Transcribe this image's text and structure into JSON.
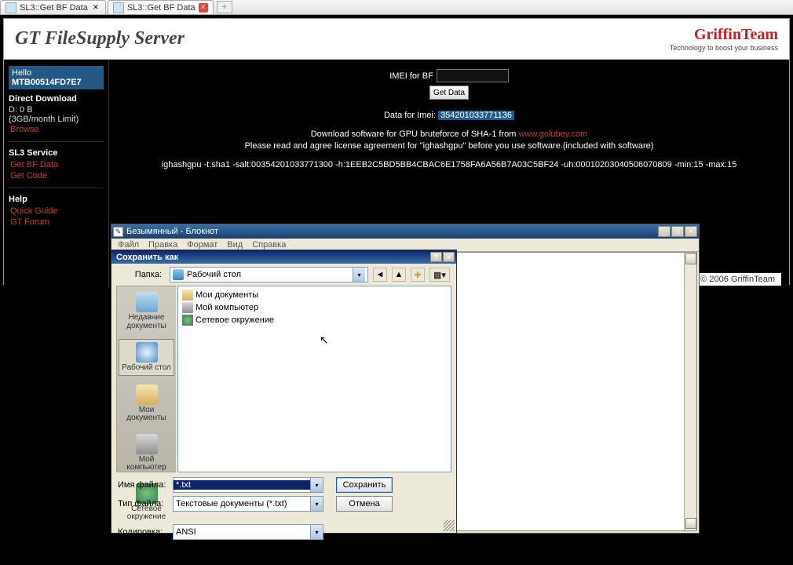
{
  "tabs": {
    "t1": "SL3::Get BF Data",
    "t2": "SL3::Get BF Data"
  },
  "header": {
    "logo": "GT FileSupply Server",
    "brand_name": "GriffinTeam",
    "brand_slogan": "Technology to boost your business"
  },
  "sidebar": {
    "hello_prefix": "Hello ",
    "hello_user": "MTB00514FD7E7",
    "dd_title": "Direct Download",
    "dd_line1": "D: 0 B",
    "dd_line2": "(3GB/month Limit)",
    "browse": "Browse",
    "sl3_title": "SL3 Service",
    "get_bf": "Get BF Data",
    "get_code": "Get Code",
    "help_title": "Help",
    "quick_guide": "Quick Guide",
    "gt_forum": "GT Forum"
  },
  "main": {
    "imei_label": "IMEI for BF",
    "get_data_btn": "Get Data",
    "data_for_label": "Data for Imei:",
    "data_for_value": "354201033771136",
    "dl_text_pre": "Download software for GPU bruteforce of SHA-1 from ",
    "dl_link": "www.golubev.com",
    "agree_text": "Please read and agree license agreement for \"ighashgpu\" before you use software.(included with software)",
    "cmdline": "ighashgpu -t:sha1 -salt:00354201033771300 -h:1EEB2C5BD5BB4CBAC6E1758FA6A56B7A03C5BF24 -uh:00010203040506070809 -min:15 -max:15"
  },
  "footer": "© 2006 GriffinTeam",
  "notepad": {
    "title": "Безымянный - Блокнот",
    "menu": {
      "file": "Файл",
      "edit": "Правка",
      "format": "Формат",
      "view": "Вид",
      "help": "Справка"
    }
  },
  "saveas": {
    "title": "Сохранить как",
    "folder_label": "Папка:",
    "folder_value": "Рабочий стол",
    "places": {
      "recent": "Недавние документы",
      "desktop": "Рабочий стол",
      "docs": "Мои документы",
      "comp": "Мой компьютер",
      "net": "Сетевое окружение"
    },
    "files": {
      "mydocs": "Мои документы",
      "mycomp": "Мой компьютер",
      "mynet": "Сетевое окружение"
    },
    "fname_label": "Имя файла:",
    "fname_value": "*.txt",
    "ftype_label": "Тип файла:",
    "ftype_value": "Текстовые документы (*.txt)",
    "enc_label": "Кодировка:",
    "enc_value": "ANSI",
    "save_btn": "Сохранить",
    "cancel_btn": "Отмена"
  }
}
